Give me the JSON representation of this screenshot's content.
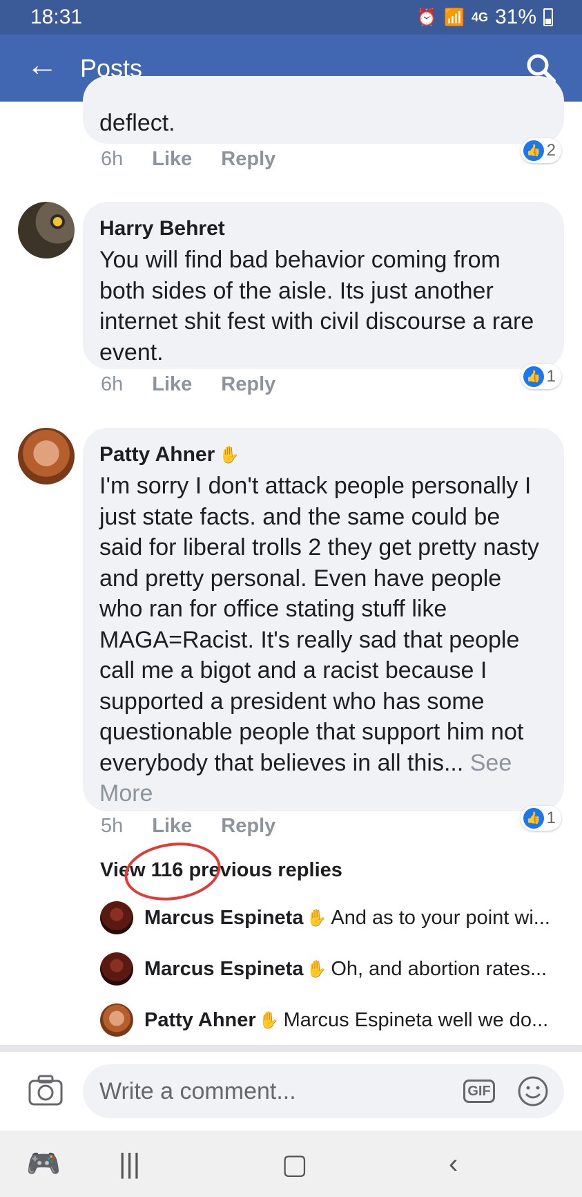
{
  "status_bar": {
    "time": "18:31",
    "network": "4G",
    "battery": "31%"
  },
  "app_bar": {
    "title": "Posts"
  },
  "comments": [
    {
      "text": "deflect.",
      "time": "6h",
      "like_label": "Like",
      "reply_label": "Reply",
      "reactions": "2"
    },
    {
      "author": "Harry Behret",
      "text": "You will find bad behavior coming from both sides of the aisle. Its just another internet shit fest with civil discourse a rare event.",
      "time": "6h",
      "like_label": "Like",
      "reply_label": "Reply",
      "reactions": "1"
    },
    {
      "author": "Patty Ahner",
      "text": "I'm sorry I don't attack people personally I just state facts. and the same could be said for liberal trolls 2 they get pretty nasty and pretty personal. Even have people who ran for office stating stuff like MAGA=Racist. It's really sad that people call me a bigot and a racist because I supported a president who has some questionable people that support him not everybody that believes in all this...",
      "see_more": "See More",
      "time": "5h",
      "like_label": "Like",
      "reply_label": "Reply",
      "reactions": "1"
    }
  ],
  "view_previous": "View 116 previous replies",
  "replies": [
    {
      "author": "Marcus Espineta",
      "text": "And as to your point wi..."
    },
    {
      "author": "Marcus Espineta",
      "text": "Oh, and abortion rates..."
    },
    {
      "author": "Patty Ahner",
      "text": "Marcus Espineta well we do..."
    }
  ],
  "composer": {
    "placeholder": "Write a comment...",
    "gif_label": "GIF"
  },
  "icons": [
    "back-arrow-icon",
    "search-icon",
    "camera-icon",
    "emoji-icon",
    "wave-icon",
    "like-icon"
  ],
  "colors": {
    "header": "#4267b2",
    "status_bar": "#3b5a98",
    "bubble": "#f0f2f5",
    "link_gray": "#8d949e",
    "like_blue": "#1877f2",
    "annotation_red": "#e53935"
  }
}
